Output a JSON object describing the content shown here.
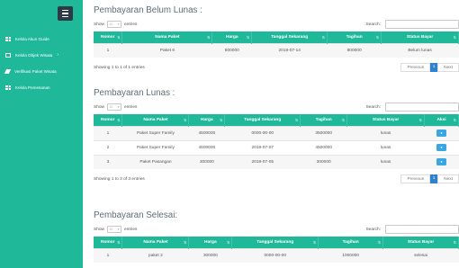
{
  "sidebar": {
    "items": [
      {
        "label": "Kelola Akun Guide",
        "icon": "grid-icon"
      },
      {
        "label": "Kelola Objek Wisata",
        "icon": "box-icon",
        "chevron": "›"
      },
      {
        "label": "Verifikasi Paket Wisata",
        "icon": "pen-icon"
      },
      {
        "label": "Kelola Pemesanan",
        "icon": "grid-icon"
      }
    ]
  },
  "common": {
    "show": "Show",
    "select_value": "10",
    "entries": "entries",
    "search": "Search:",
    "previous": "Previous",
    "next": "Next",
    "page": "1",
    "aksi_icon": "eye-icon"
  },
  "belum": {
    "title": "Pembayaran Belum Lunas :",
    "headers": [
      "Nomor",
      "Nama Paket",
      "Harga",
      "Tanggal Sekarang",
      "Tagihan",
      "Status Bayar"
    ],
    "rows": [
      [
        "1",
        "Paket 6",
        "800000",
        "2018-07-14",
        "800000",
        "Belum lunas"
      ]
    ],
    "info": "Showing 1 to 1 of 1 entries"
  },
  "lunas": {
    "title": "Pembayaran Lunas :",
    "headers": [
      "Nomor",
      "Nama Paket",
      "Harga",
      "Tanggal Sekarang",
      "Tagihan",
      "Status Bayar",
      "Aksi"
    ],
    "rows": [
      [
        "1",
        "Paket Super Family",
        "4500000",
        "0000-00-00",
        "3500000",
        "lunas"
      ],
      [
        "2",
        "Paket Super Family",
        "4500000",
        "2018-07-07",
        "4500000",
        "lunas"
      ],
      [
        "3",
        "Paket Pasangan",
        "300000",
        "2018-07-05",
        "300000",
        "lunas"
      ]
    ],
    "info": "Showing 1 to 3 of 3 entries"
  },
  "selesai": {
    "title": "Pembayaran Selesai:",
    "headers": [
      "Nomor",
      "Nama Paket",
      "Harga",
      "Tanggal Sekarang",
      "Tagihan",
      "Status Bayar"
    ],
    "rows": [
      [
        "1",
        "paket 2",
        "300000",
        "0000-00-00",
        "1000000",
        "selesai"
      ]
    ]
  },
  "colors": {
    "accent": "#1fb899",
    "hamburger": "#2d3a45",
    "action_button": "#3aa6e3",
    "active_page": "#2f80cd"
  }
}
